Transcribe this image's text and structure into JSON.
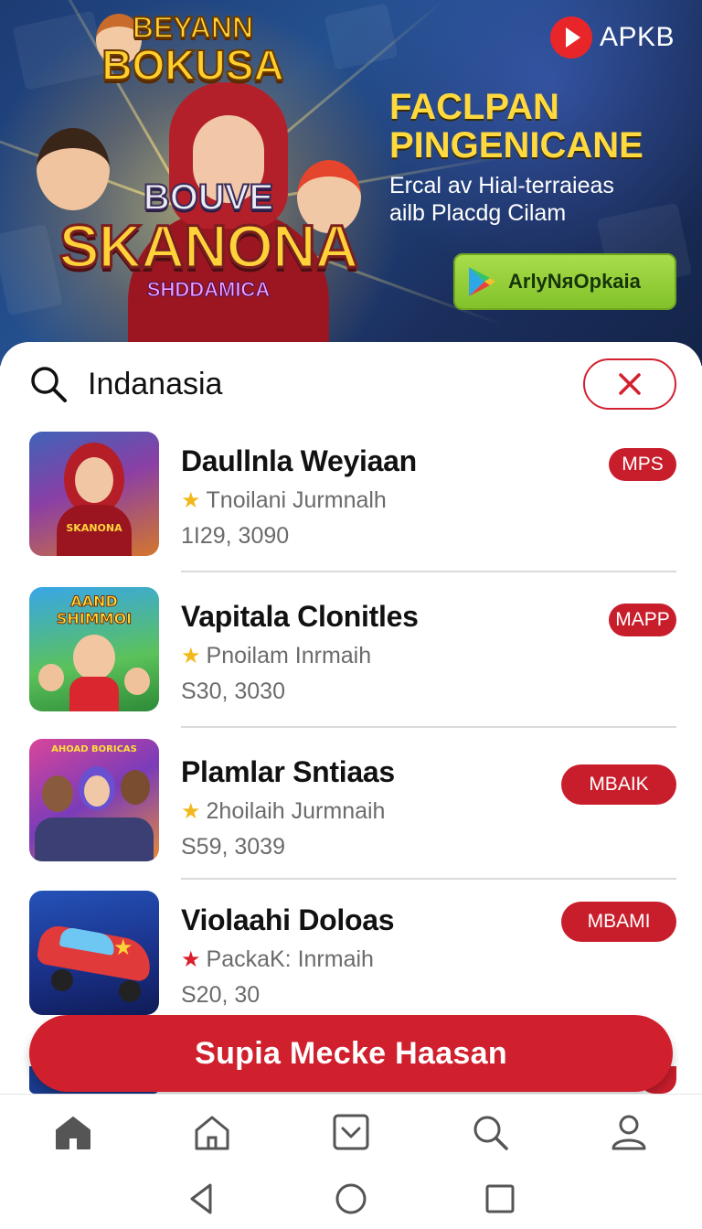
{
  "banner": {
    "brand": "APKB",
    "title_top_line1": "BEYANN",
    "title_top_line2": "BOKUSA",
    "title_big_line1": "BOUVE",
    "title_big_line2": "SKANONA",
    "title_big_line3": "SHDDAMICA",
    "promo_heading_line1": "FACLPAN",
    "promo_heading_line2": "PINGENICANE",
    "promo_sub_line1": "Ercal av Hial-terraieas",
    "promo_sub_line2": "ailb Placdg Cilam",
    "cta_label": "ArlyNяOpkaia"
  },
  "search": {
    "query": "Indanasia"
  },
  "apps": [
    {
      "name": "Daullnla Weyiaan",
      "meta": "Tnoilani Jurmnalh",
      "size": "1I29, 3090",
      "badge": "MPS",
      "star_color": "#f2b91d",
      "thumb_label": "SKANONA"
    },
    {
      "name": "Vapitala Clonitles",
      "meta": "Pnoilam Inrmaih",
      "size": "S30, 3030",
      "badge": "MAPP",
      "star_color": "#f2b91d",
      "thumb_label": "AAND SHIMMOI"
    },
    {
      "name": "Plamlar Sntiaas",
      "meta": "2hoilaih Jurmnaih",
      "size": "S59, 3039",
      "badge": "MBAIK",
      "star_color": "#f2b91d",
      "thumb_label": "AHOAD BORICAS"
    },
    {
      "name": "Violaahi Doloas",
      "meta": "PackaK: Inrmaih",
      "size": "S20, 30",
      "badge": "MBAMI",
      "star_color": "#d91f2b",
      "thumb_label": ""
    }
  ],
  "install_bar": {
    "label": "Supia Mecke Haasan"
  },
  "colors": {
    "accent_red": "#d01f2d",
    "badge_red": "#c81e2c",
    "cta_green": "#8fcb32",
    "headline_yellow": "#ffd93d"
  },
  "icons": {
    "brand": "play-logo-icon",
    "search": "search-icon",
    "clear": "close-icon",
    "nav": [
      "home-filled-icon",
      "home-outline-icon",
      "download-box-icon",
      "search-icon",
      "profile-icon"
    ],
    "system": [
      "back-icon",
      "home-circle-icon",
      "recents-icon"
    ]
  }
}
